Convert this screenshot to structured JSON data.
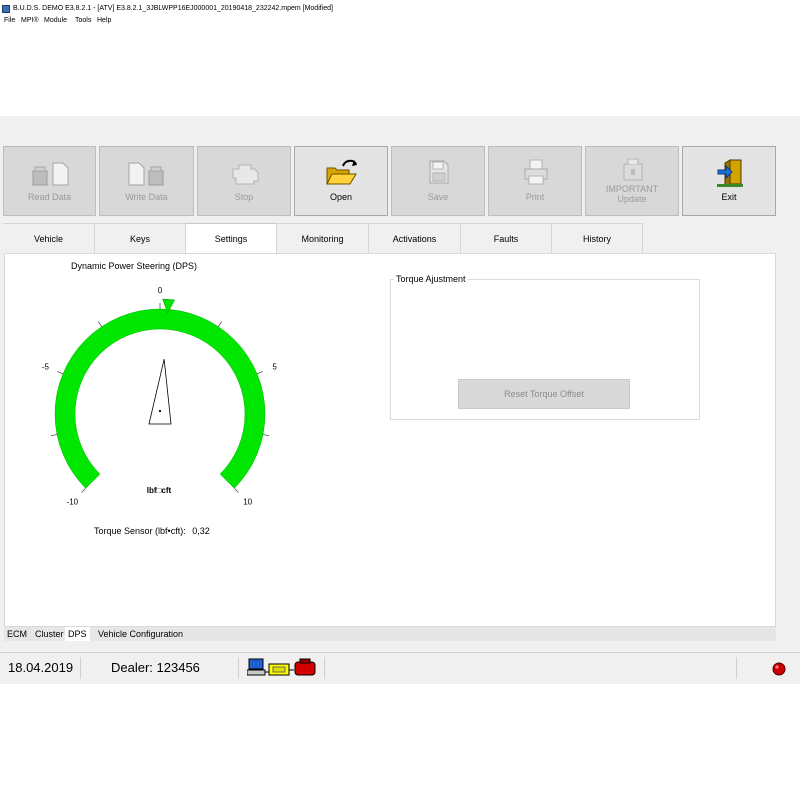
{
  "window": {
    "title": "B.U.D.S. DEMO E3.8.2.1 - [ATV] E3.8.2.1_3JBLWPP16EJ000001_20190418_232242.mpem [Modified]"
  },
  "menu": [
    "File",
    "MPI®",
    "Module",
    "Tools",
    "Help"
  ],
  "toolbar": {
    "read_data": "Read Data",
    "write_data": "Write Data",
    "stop": "Stop",
    "open": "Open",
    "save": "Save",
    "print": "Print",
    "important_line1": "IMPORTANT",
    "important_line2": "Update",
    "exit": "Exit"
  },
  "tabs": [
    "Vehicle",
    "Keys",
    "Settings",
    "Monitoring",
    "Activations",
    "Faults",
    "History"
  ],
  "active_tab": "Settings",
  "gauge": {
    "title": "Dynamic Power Steering (DPS)",
    "unit": "lbf□cft",
    "tick_labels": {
      "min": "-10",
      "neg": "-5",
      "zero": "0",
      "pos": "5",
      "max": "10"
    },
    "min": -10,
    "max": 10,
    "value": 0.32,
    "arc_color": "#00e600",
    "sensor_label": "Torque Sensor (lbf•cft):",
    "sensor_value": "0,32"
  },
  "torque_group": {
    "title": "Torque Ajustment",
    "reset_button": "Reset Torque Offset"
  },
  "bottom_tabs": [
    "ECM",
    "Cluster",
    "DPS",
    "Vehicle Configuration"
  ],
  "active_bottom_tab": "DPS",
  "status": {
    "date": "18.04.2019",
    "dealer": "Dealer: 123456",
    "indicator_color": "#cc0000"
  }
}
